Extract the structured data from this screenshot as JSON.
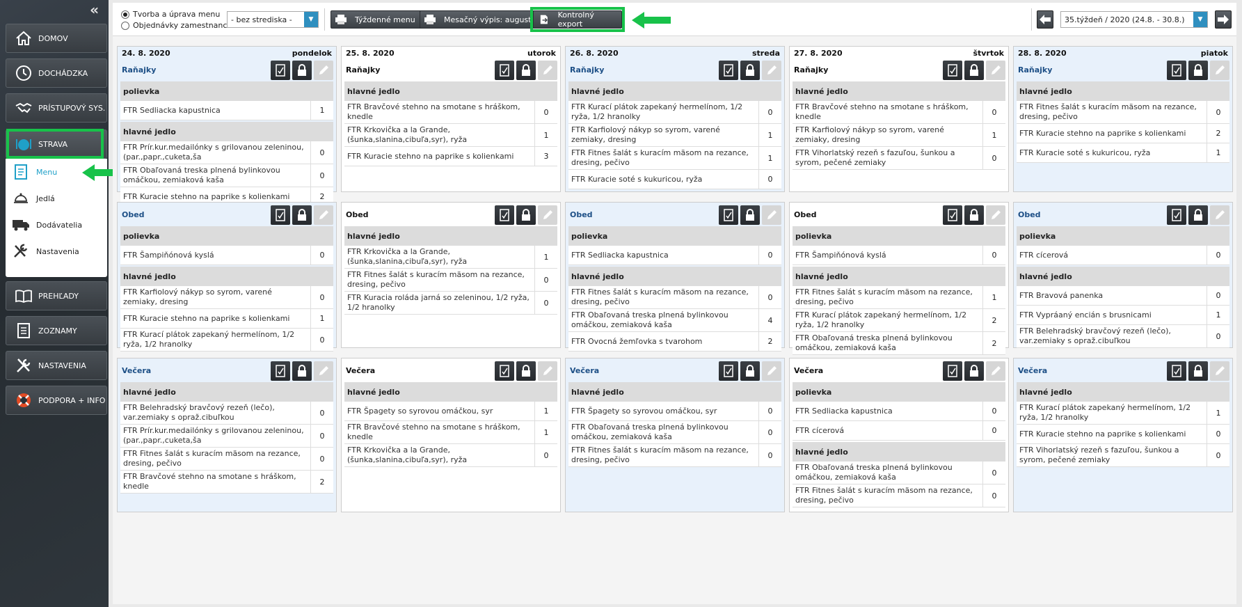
{
  "sidebar": {
    "collapse_glyph": "«",
    "items": [
      {
        "label": "DOMOV",
        "icon": "home-icon"
      },
      {
        "label": "DOCHÁDZKA",
        "icon": "clock-icon"
      },
      {
        "label": "PRÍSTUPOVÝ SYS.",
        "icon": "handshake-icon"
      },
      {
        "label": "STRAVA",
        "icon": "plate-icon"
      },
      {
        "label": "PREHĽADY",
        "icon": "book-icon"
      },
      {
        "label": "ZOZNAMY",
        "icon": "list-icon"
      },
      {
        "label": "NASTAVENIA",
        "icon": "tools-icon"
      },
      {
        "label": "PODPORA + INFO",
        "icon": "lifebuoy-icon"
      }
    ],
    "submenu": [
      {
        "label": "Menu",
        "icon": "menu-doc-icon",
        "active": true
      },
      {
        "label": "Jedlá",
        "icon": "cloche-icon",
        "active": false
      },
      {
        "label": "Dodávatelia",
        "icon": "truck-icon",
        "active": false
      },
      {
        "label": "Nastavenia",
        "icon": "wrench-icon",
        "active": false
      }
    ]
  },
  "toolbar": {
    "mode_options": [
      {
        "label": "Tvorba a úprava menu",
        "selected": true
      },
      {
        "label": "Objednávky zamestnanca",
        "selected": false
      }
    ],
    "center_select": "- bez strediska -",
    "weekly_menu": "Týždenné menu",
    "monthly_report": "Mesačný výpis: august",
    "control_export": "Kontrolný export",
    "week_select": "35.týždeň / 2020 (24.8. - 30.8.)"
  },
  "colors": {
    "highlight": "#18c24a",
    "accent": "#2f8fbf",
    "meal_title_blue": "#1d4f86"
  },
  "days": [
    {
      "date": "24. 8. 2020",
      "weekday": "pondelok",
      "theme": "blue",
      "meals": [
        {
          "name": "Raňajky",
          "groups": [
            {
              "category": "polievka",
              "dishes": [
                {
                  "name": "FTR Sedliacka kapustnica",
                  "qty": "1"
                }
              ]
            },
            {
              "category": "hlavné jedlo",
              "dishes": [
                {
                  "name": "FTR Prír.kur.medailónky s grilovanou zeleninou,(par.,papr.,cuketa,ša",
                  "qty": "0"
                },
                {
                  "name": "FTR Obaľovaná treska plnená bylinkovou omáčkou, zemiaková kaša",
                  "qty": "0"
                },
                {
                  "name": "FTR Kuracie stehno na paprike s kolienkami",
                  "qty": "2"
                }
              ]
            }
          ]
        },
        {
          "name": "Obed",
          "groups": [
            {
              "category": "polievka",
              "dishes": [
                {
                  "name": "FTR Šampiňónová kyslá",
                  "qty": "0"
                }
              ]
            },
            {
              "category": "hlavné jedlo",
              "dishes": [
                {
                  "name": "FTR Karfiolový nákyp so syrom, varené zemiaky, dresing",
                  "qty": "0"
                },
                {
                  "name": "FTR Kuracie stehno na paprike s kolienkami",
                  "qty": "1"
                },
                {
                  "name": "FTR Kurací plátok zapekaný hermelínom, 1/2 ryža, 1/2 hranolky",
                  "qty": "0"
                }
              ]
            }
          ]
        },
        {
          "name": "Večera",
          "groups": [
            {
              "category": "hlavné jedlo",
              "dishes": [
                {
                  "name": "FTR Belehradský bravčový rezeň (lečo), var.zemiaky s opraž.cibuľkou",
                  "qty": "0"
                },
                {
                  "name": "FTR Prír.kur.medailónky s grilovanou zeleninou,(par.,papr.,cuketa,ša",
                  "qty": "0"
                },
                {
                  "name": "FTR Fitnes šalát s kuracím mäsom na rezance, dresing, pečivo",
                  "qty": "0"
                },
                {
                  "name": "FTR Bravčové stehno na smotane s hráškom, knedle",
                  "qty": "2"
                }
              ]
            }
          ]
        }
      ]
    },
    {
      "date": "25. 8. 2020",
      "weekday": "utorok",
      "theme": "white",
      "meals": [
        {
          "name": "Raňajky",
          "groups": [
            {
              "category": "hlavné jedlo",
              "dishes": [
                {
                  "name": "FTR Bravčové stehno na smotane s hráškom, knedle",
                  "qty": "0"
                },
                {
                  "name": "FTR Krkovička a la Grande, (šunka,slanina,cibuľa,syr), ryža",
                  "qty": "1"
                },
                {
                  "name": "FTR Kuracie stehno na paprike s kolienkami",
                  "qty": "3"
                }
              ]
            }
          ]
        },
        {
          "name": "Obed",
          "groups": [
            {
              "category": "hlavné jedlo",
              "dishes": [
                {
                  "name": "FTR Krkovička a la Grande, (šunka,slanina,cibuľa,syr), ryža",
                  "qty": "1"
                },
                {
                  "name": "FTR Fitnes šalát s kuracím mäsom na rezance, dresing, pečivo",
                  "qty": "0"
                },
                {
                  "name": "FTR Kuracia roláda jarná so zeleninou, 1/2 ryža, 1/2 hranolky",
                  "qty": "0"
                }
              ]
            }
          ]
        },
        {
          "name": "Večera",
          "groups": [
            {
              "category": "hlavné jedlo",
              "dishes": [
                {
                  "name": "FTR Špagety so syrovou omáčkou, syr",
                  "qty": "1"
                },
                {
                  "name": "FTR Bravčové stehno na smotane s hráškom, knedle",
                  "qty": "1"
                },
                {
                  "name": "FTR Krkovička a la Grande, (šunka,slanina,cibuľa,syr), ryža",
                  "qty": "0"
                }
              ]
            }
          ]
        }
      ]
    },
    {
      "date": "26. 8. 2020",
      "weekday": "streda",
      "theme": "blue",
      "meals": [
        {
          "name": "Raňajky",
          "groups": [
            {
              "category": "hlavné jedlo",
              "dishes": [
                {
                  "name": "FTR Kurací plátok zapekaný hermelínom, 1/2 ryža, 1/2 hranolky",
                  "qty": "0"
                },
                {
                  "name": "FTR Karfiolový nákyp so syrom, varené zemiaky, dresing",
                  "qty": "1"
                },
                {
                  "name": "FTR Fitnes šalát s kuracím mäsom na rezance, dresing, pečivo",
                  "qty": "1"
                },
                {
                  "name": "FTR Kuracie soté s kukuricou, ryža",
                  "qty": "0"
                }
              ]
            }
          ]
        },
        {
          "name": "Obed",
          "groups": [
            {
              "category": "polievka",
              "dishes": [
                {
                  "name": "FTR Sedliacka kapustnica",
                  "qty": "0"
                }
              ]
            },
            {
              "category": "hlavné jedlo",
              "dishes": [
                {
                  "name": "FTR Fitnes šalát s kuracím mäsom na rezance, dresing, pečivo",
                  "qty": "0"
                },
                {
                  "name": "FTR Obaľovaná treska plnená bylinkovou omáčkou, zemiaková kaša",
                  "qty": "4"
                },
                {
                  "name": "FTR Ovocná žemľovka s tvarohom",
                  "qty": "2"
                }
              ]
            }
          ]
        },
        {
          "name": "Večera",
          "groups": [
            {
              "category": "hlavné jedlo",
              "dishes": [
                {
                  "name": "FTR Špagety so syrovou omáčkou, syr",
                  "qty": "0"
                },
                {
                  "name": "FTR Obaľovaná treska plnená bylinkovou omáčkou, zemiaková kaša",
                  "qty": "0"
                },
                {
                  "name": "FTR Fitnes šalát s kuracím mäsom na rezance, dresing, pečivo",
                  "qty": "0"
                }
              ]
            }
          ]
        }
      ]
    },
    {
      "date": "27. 8. 2020",
      "weekday": "štvrtok",
      "theme": "white",
      "meals": [
        {
          "name": "Raňajky",
          "groups": [
            {
              "category": "hlavné jedlo",
              "dishes": [
                {
                  "name": "FTR Bravčové stehno na smotane s hráškom, knedle",
                  "qty": "0"
                },
                {
                  "name": "FTR Karfiolový nákyp so syrom, varené zemiaky, dresing",
                  "qty": "1"
                },
                {
                  "name": "FTR Vihorlatský rezeň s fazuľou, šunkou a syrom, pečené zemiaky",
                  "qty": "0"
                }
              ]
            }
          ]
        },
        {
          "name": "Obed",
          "groups": [
            {
              "category": "polievka",
              "dishes": [
                {
                  "name": "FTR Šampiňónová kyslá",
                  "qty": "0"
                }
              ]
            },
            {
              "category": "hlavné jedlo",
              "dishes": [
                {
                  "name": "FTR Fitnes šalát s kuracím mäsom na rezance, dresing, pečivo",
                  "qty": "1"
                },
                {
                  "name": "FTR Kurací plátok zapekaný hermelínom, 1/2 ryža, 1/2 hranolky",
                  "qty": "2"
                },
                {
                  "name": "FTR Obaľovaná treska plnená bylinkovou omáčkou, zemiaková kaša",
                  "qty": "2"
                }
              ]
            }
          ]
        },
        {
          "name": "Večera",
          "groups": [
            {
              "category": "polievka",
              "dishes": [
                {
                  "name": "FTR Sedliacka kapustnica",
                  "qty": "0"
                },
                {
                  "name": "FTR cícerová",
                  "qty": "0"
                }
              ]
            },
            {
              "category": "hlavné jedlo",
              "dishes": [
                {
                  "name": "FTR Obaľovaná treska plnená bylinkovou omáčkou, zemiaková kaša",
                  "qty": "0"
                },
                {
                  "name": "FTR Fitnes šalát s kuracím mäsom na rezance, dresing, pečivo",
                  "qty": "0"
                }
              ]
            }
          ]
        }
      ]
    },
    {
      "date": "28. 8. 2020",
      "weekday": "piatok",
      "theme": "blue",
      "meals": [
        {
          "name": "Raňajky",
          "groups": [
            {
              "category": "hlavné jedlo",
              "dishes": [
                {
                  "name": "FTR Fitnes šalát s kuracím mäsom na rezance, dresing, pečivo",
                  "qty": "0"
                },
                {
                  "name": "FTR Kuracie stehno na paprike s kolienkami",
                  "qty": "2"
                },
                {
                  "name": "FTR Kuracie soté s kukuricou, ryža",
                  "qty": "1"
                }
              ]
            }
          ]
        },
        {
          "name": "Obed",
          "groups": [
            {
              "category": "polievka",
              "dishes": [
                {
                  "name": "FTR cícerová",
                  "qty": "0"
                }
              ]
            },
            {
              "category": "hlavné jedlo",
              "dishes": [
                {
                  "name": "FTR Bravová panenka",
                  "qty": "0"
                },
                {
                  "name": "FTR Vypráaný encián s brusnicami",
                  "qty": "1"
                },
                {
                  "name": "FTR Belehradský bravčový rezeň (lečo), var.zemiaky s opraž.cibuľkou",
                  "qty": "0"
                }
              ]
            }
          ]
        },
        {
          "name": "Večera",
          "groups": [
            {
              "category": "hlavné jedlo",
              "dishes": [
                {
                  "name": "FTR Kurací plátok zapekaný hermelínom, 1/2 ryža, 1/2 hranolky",
                  "qty": "1"
                },
                {
                  "name": "FTR Kuracie stehno na paprike s kolienkami",
                  "qty": "0"
                },
                {
                  "name": "FTR Vihorlatský rezeň s fazuľou, šunkou a syrom, pečené zemiaky",
                  "qty": "0"
                }
              ]
            }
          ]
        }
      ]
    }
  ]
}
